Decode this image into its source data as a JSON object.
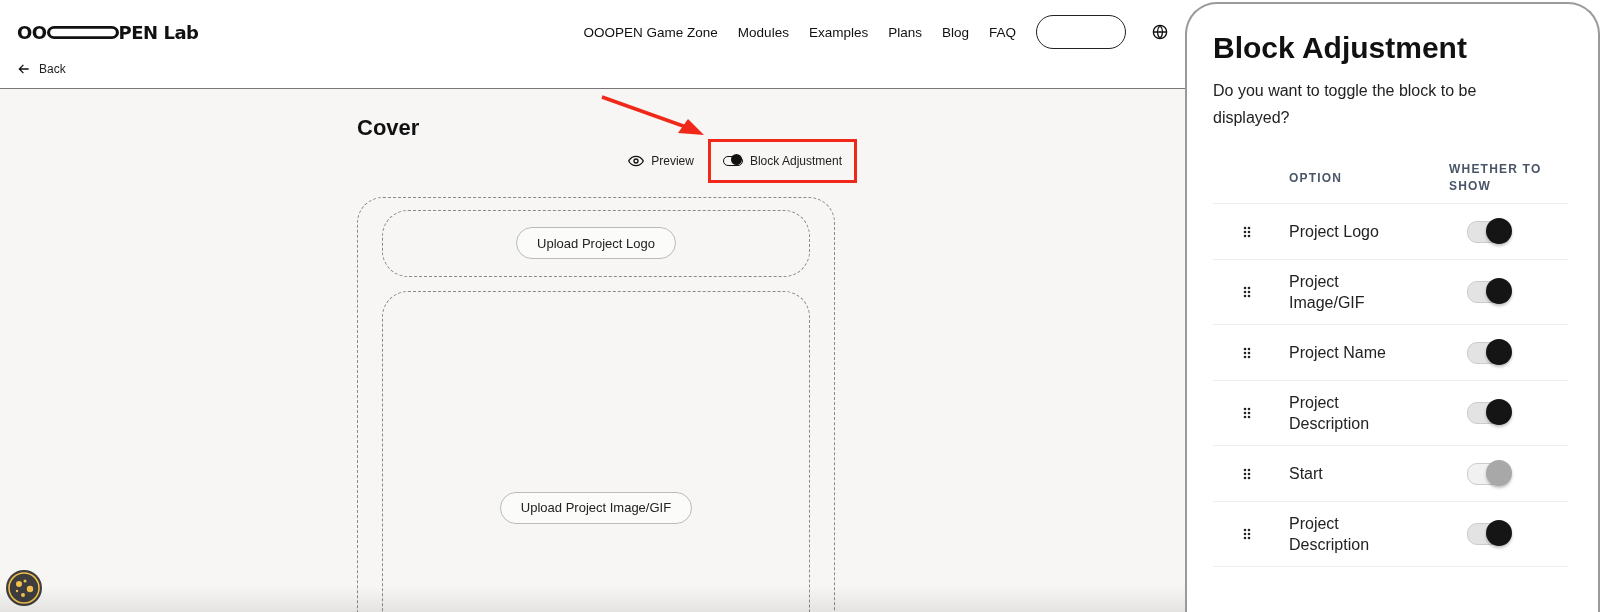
{
  "header": {
    "logo": {
      "before": "OO",
      "after": "PEN Lab"
    },
    "nav": [
      "OOOPEN Game Zone",
      "Modules",
      "Examples",
      "Plans",
      "Blog",
      "FAQ"
    ],
    "back": "Back"
  },
  "editor": {
    "title": "Cover",
    "preview": "Preview",
    "block_adjustment": {
      "label": "Block Adjustment",
      "on": true
    },
    "upload_buttons": [
      "Upload Project Logo",
      "Upload Project Image/GIF"
    ]
  },
  "panel": {
    "title": "Block Adjustment",
    "description": "Do you want to toggle the block to be displayed?",
    "columns": [
      "OPTION",
      "WHETHER TO SHOW"
    ],
    "rows": [
      {
        "option": "Project Logo",
        "on": true,
        "disabled": false
      },
      {
        "option": "Project Image/GIF",
        "on": true,
        "disabled": false
      },
      {
        "option": "Project Name",
        "on": true,
        "disabled": false
      },
      {
        "option": "Project Description",
        "on": true,
        "disabled": false
      },
      {
        "option": "Start",
        "on": true,
        "disabled": true
      },
      {
        "option": "Project Description",
        "on": true,
        "disabled": false
      }
    ]
  }
}
